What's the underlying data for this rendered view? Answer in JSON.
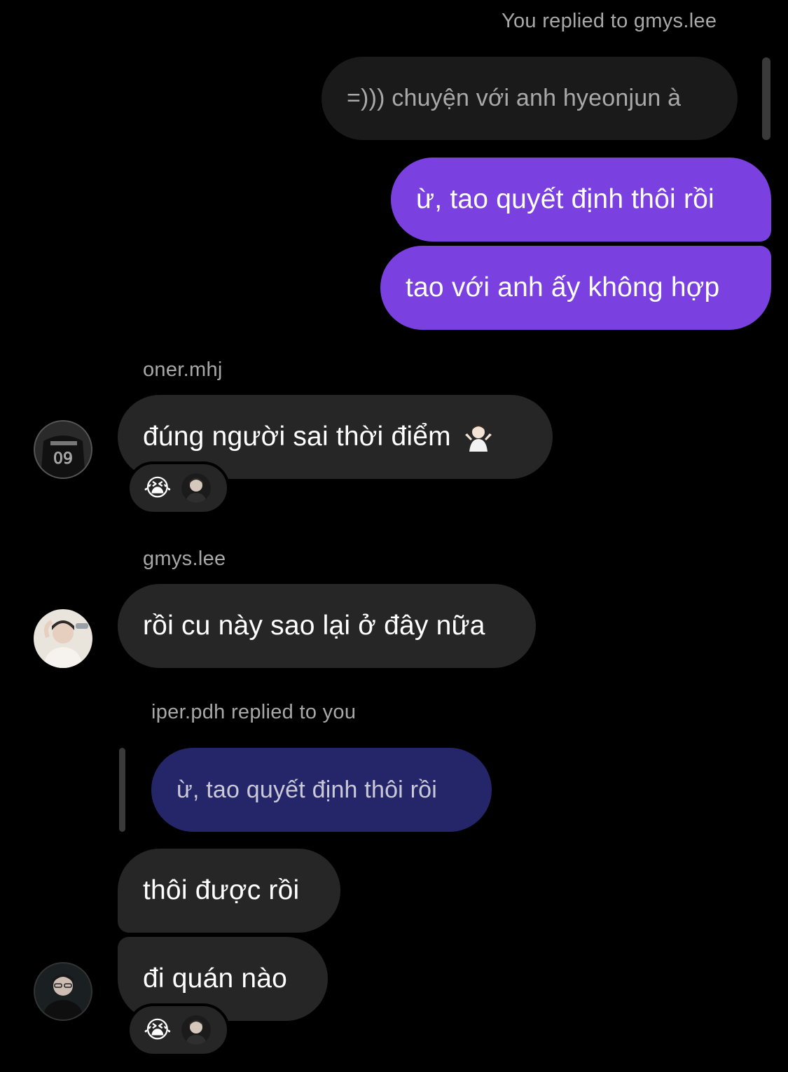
{
  "thread": {
    "outgoing_reply_header": "You replied to gmys.lee",
    "outgoing_quoted_text": "=))) chuyện với anh hyeonjun à",
    "outgoing_messages": [
      "ừ, tao quyết định thôi rồi",
      "tao với anh ấy không hợp"
    ],
    "groups": [
      {
        "username": "oner.mhj",
        "messages": [
          "đúng người sai thời điểm"
        ],
        "emoji_in_message": "person-shrugging",
        "reaction_emoji": "😭",
        "reaction_emoji_name": "loudly-crying-face"
      },
      {
        "username": "gmys.lee",
        "messages": [
          "rồi cu này sao lại ở đây nữa"
        ]
      },
      {
        "reply_header": "iper.pdh replied to you",
        "quoted_text": "ừ, tao quyết định thôi rồi",
        "messages": [
          "thôi được rồi",
          "đi quán nào"
        ],
        "reaction_emoji": "😭",
        "reaction_emoji_name": "loudly-crying-face"
      }
    ]
  },
  "colors": {
    "background": "#000000",
    "outgoing_bubble": "#7a41e0",
    "incoming_bubble": "#262626",
    "quoted_incoming": "#25266a",
    "meta_text": "#a8a8a8"
  }
}
